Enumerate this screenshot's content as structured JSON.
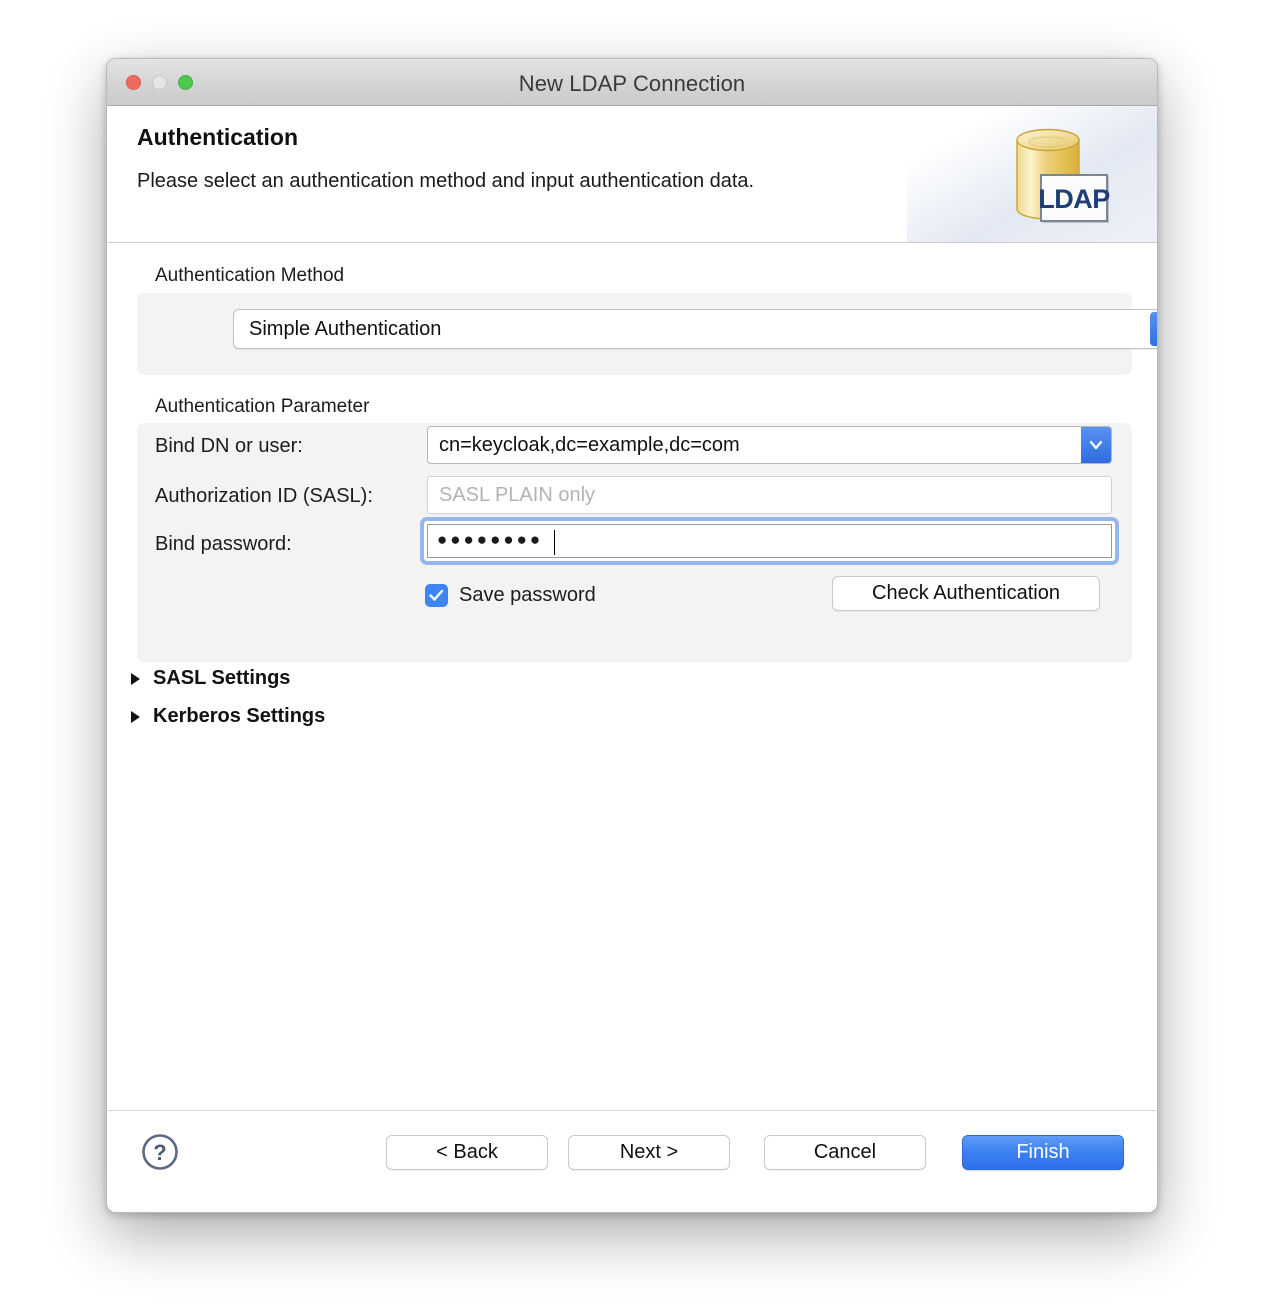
{
  "window": {
    "title": "New LDAP Connection",
    "traffic_lights": {
      "close": "close-button",
      "minimize": "minimize-button",
      "zoom": "zoom-button"
    }
  },
  "header": {
    "title": "Authentication",
    "description": "Please select an authentication method and input authentication data.",
    "icon_label": "LDAP",
    "icon_name": "ldap-database-icon"
  },
  "auth_method": {
    "group_label": "Authentication Method",
    "selected": "Simple Authentication"
  },
  "auth_parameter": {
    "group_label": "Authentication Parameter",
    "bind_dn": {
      "label": "Bind DN or user:",
      "value": "cn=keycloak,dc=example,dc=com"
    },
    "authorization_id": {
      "label": "Authorization ID (SASL):",
      "value": "",
      "placeholder": "SASL PLAIN only"
    },
    "bind_password": {
      "label": "Bind password:",
      "masked_value": "●●●●●●●●"
    },
    "save_password": {
      "label": "Save password",
      "checked": true
    },
    "check_authentication_label": "Check Authentication"
  },
  "sections": [
    {
      "label": "SASL Settings",
      "expanded": false
    },
    {
      "label": "Kerberos Settings",
      "expanded": false
    }
  ],
  "footer": {
    "help_label": "?",
    "back_label": "< Back",
    "next_label": "Next >",
    "cancel_label": "Cancel",
    "finish_label": "Finish"
  },
  "colors": {
    "accent_blue": "#3c81f2",
    "focus_ring": "#96b6ef",
    "checkbox_blue": "#3f84f4",
    "group_background": "#f3f3f3",
    "placeholder_text": "#b3b3b3",
    "ldap_icon_gold": "#e8c85a",
    "ldap_icon_text": "#1f3e78"
  }
}
